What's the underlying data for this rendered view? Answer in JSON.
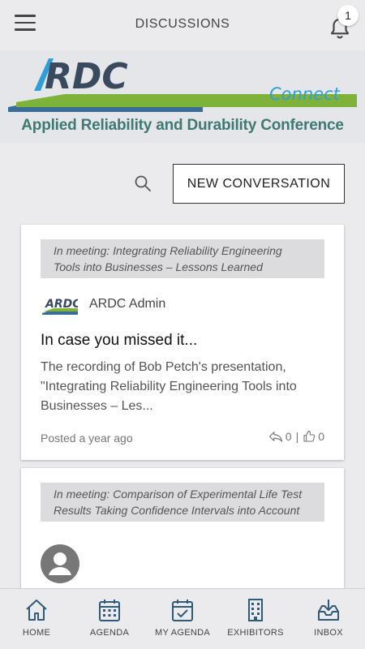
{
  "header": {
    "title": "DISCUSSIONS",
    "notification_count": "1"
  },
  "banner": {
    "logo_text": "ARDC",
    "connect_text": "Connect",
    "conference_name": "Applied Reliability and Durability Conference"
  },
  "actions": {
    "new_conversation_label": "NEW CONVERSATION"
  },
  "posts": [
    {
      "meeting": "In meeting: Integrating Reliability Engineering Tools into Businesses – Lessons Learned",
      "author": "ARDC Admin",
      "title": "In case you missed it...",
      "body": "The recording of Bob Petch's presentation, \"Integrating Reliability Engineering Tools into Businesses – Les...",
      "posted": "Posted a year ago",
      "replies": "0",
      "likes": "0"
    },
    {
      "meeting": "In meeting: Comparison of Experimental Life Test Results Taking Confidence Intervals into Account"
    }
  ],
  "tabs": [
    {
      "label": "HOME",
      "icon": "home-icon"
    },
    {
      "label": "AGENDA",
      "icon": "calendar-icon"
    },
    {
      "label": "MY AGENDA",
      "icon": "calendar-check-icon"
    },
    {
      "label": "EXHIBITORS",
      "icon": "building-icon"
    },
    {
      "label": "INBOX",
      "icon": "inbox-icon"
    }
  ],
  "colors": {
    "background": "#ebebed",
    "banner_text": "#3f7a72",
    "connect_blue": "#2f9fd6",
    "logo_green": "#7fb23a"
  }
}
